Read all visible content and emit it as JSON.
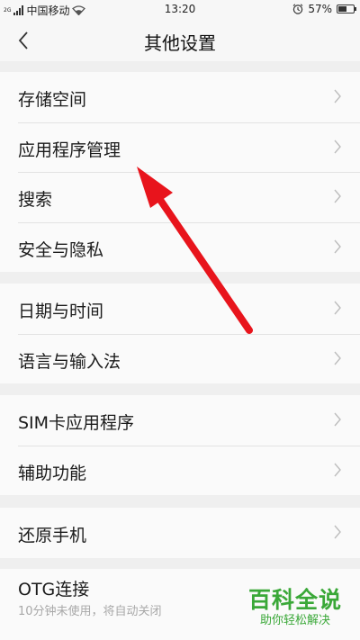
{
  "status_bar": {
    "network_type": "2G",
    "carrier": "中国移动",
    "time": "13:20",
    "battery_percent": "57%",
    "battery_level": 0.57
  },
  "header": {
    "title": "其他设置",
    "back_icon": "chevron-left-icon"
  },
  "settings_groups": [
    {
      "items": [
        {
          "label": "存储空间"
        },
        {
          "label": "应用程序管理"
        },
        {
          "label": "搜索"
        },
        {
          "label": "安全与隐私"
        }
      ]
    },
    {
      "items": [
        {
          "label": "日期与时间"
        },
        {
          "label": "语言与输入法"
        }
      ]
    },
    {
      "items": [
        {
          "label": "SIM卡应用程序"
        },
        {
          "label": "辅助功能"
        }
      ]
    },
    {
      "items": [
        {
          "label": "还原手机"
        }
      ]
    },
    {
      "items": [
        {
          "label": "OTG连接",
          "sublabel": "10分钟未使用，将自动关闭"
        }
      ]
    }
  ],
  "annotation": {
    "color": "#e8141c",
    "target": "应用程序管理"
  },
  "watermark": {
    "title": "百科全说",
    "subtitle": "助你轻松解决",
    "color": "#3aa838"
  }
}
